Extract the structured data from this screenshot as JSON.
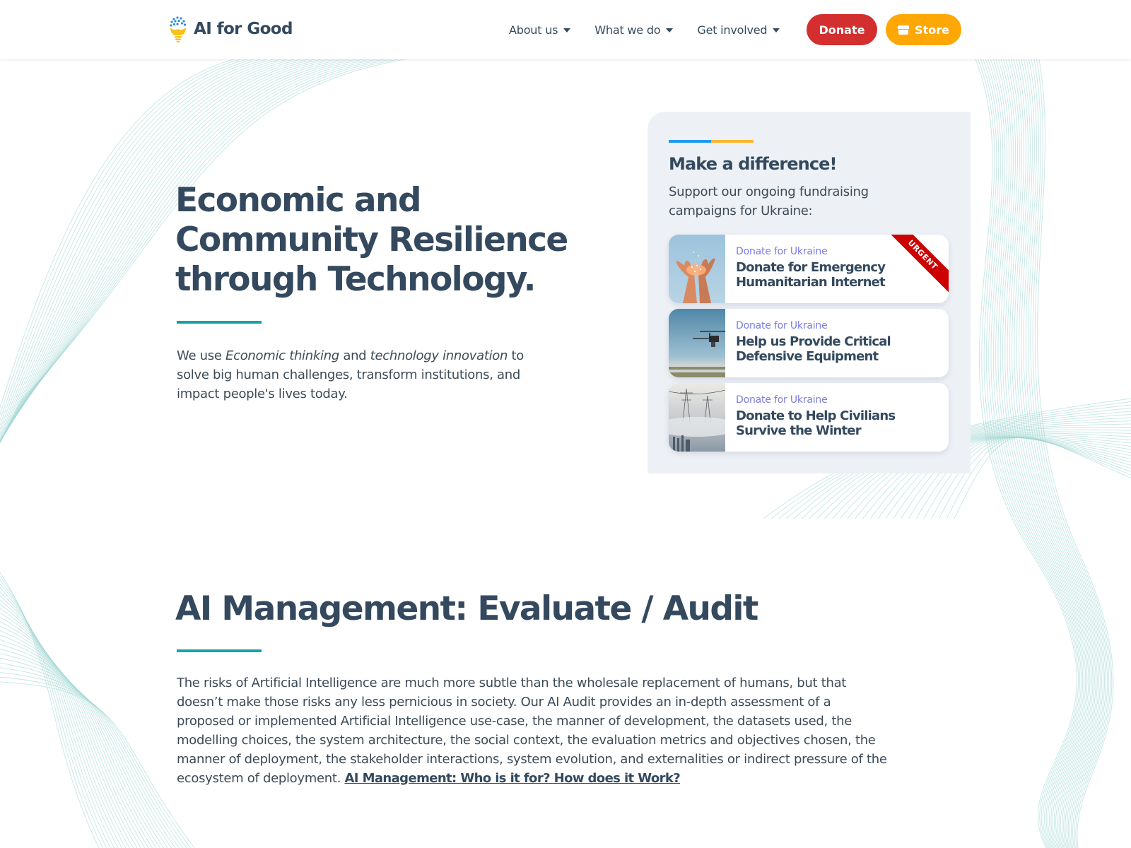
{
  "header": {
    "logo_text": "AI for Good",
    "nav": [
      {
        "label": "About us",
        "icon": "caret-down-icon"
      },
      {
        "label": "What we do",
        "icon": "caret-down-icon"
      },
      {
        "label": "Get involved",
        "icon": "caret-down-icon"
      }
    ],
    "donate_label": "Donate",
    "store_label": "Store",
    "colors": {
      "donate": "#d32f2f",
      "store": "#ffa705"
    }
  },
  "hero": {
    "title_lines": [
      "Economic and",
      "Community Resilience",
      "through Technology."
    ],
    "text": {
      "p1": "We use ",
      "em1": "Economic thinking",
      "p2": " and ",
      "em2": "technology innovation",
      "p3": " to solve big human challenges, transform institutions, and impact people's lives today."
    },
    "accent_color": "#17a2a6"
  },
  "fundraising": {
    "title": "Make a difference!",
    "subtitle": "Support our ongoing fundraising campaigns for Ukraine:",
    "flag_colors": [
      "#1e9af0",
      "#fbb92f"
    ],
    "campaigns": [
      {
        "kicker": "Donate for Ukraine",
        "title": "Donate for Emergency Humanitarian Internet",
        "badge": "URGENT",
        "image": "hands-with-lights"
      },
      {
        "kicker": "Donate for Ukraine",
        "title": "Help us Provide Critical Defensive Equipment",
        "badge": "",
        "image": "drone-over-water"
      },
      {
        "kicker": "Donate for Ukraine",
        "title": "Donate to Help Civilians Survive the Winter",
        "badge": "",
        "image": "power-lines-in-fog"
      }
    ]
  },
  "section_audit": {
    "title": "AI Management: Evaluate / Audit",
    "body": "The risks of Artificial Intelligence are much more subtle than the wholesale replacement of humans, but that doesn’t make those risks any less pernicious in society. Our AI Audit provides an in-depth assessment of a proposed or implemented Artificial Intelligence use-case, the manner of development, the datasets used, the modelling choices, the system architecture, the social context, the evaluation metrics and objectives chosen, the manner of deployment, the stakeholder interactions, system evolution, and externalities or indirect pressure of the ecosystem of deployment. ",
    "link_label": "AI Management: Who is it for? How does it Work?"
  }
}
